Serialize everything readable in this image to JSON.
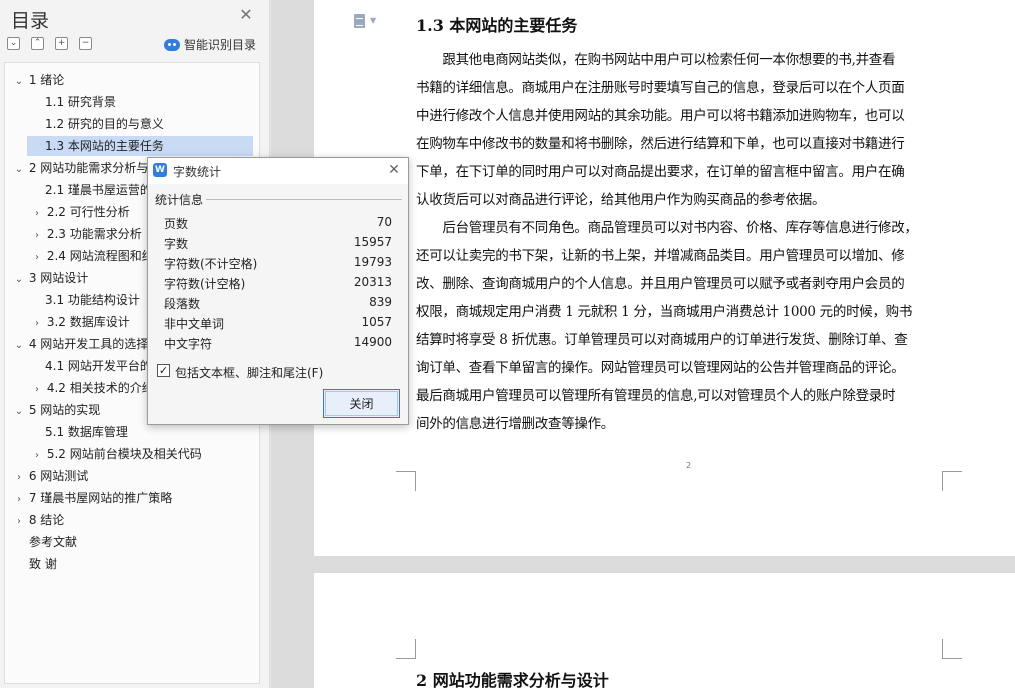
{
  "nav": {
    "title": "目录",
    "close_glyph": "✕",
    "tools": [
      "⌄",
      "⌃",
      "+",
      "−"
    ],
    "smart_toc_label": "智能识别目录",
    "items": [
      {
        "caret": "⌄",
        "label": "1  绪论"
      },
      {
        "caret": "",
        "label": "1.1  研究背景"
      },
      {
        "caret": "",
        "label": "1.2  研究的目的与意义"
      },
      {
        "caret": "",
        "label": "1.3  本网站的主要任务",
        "selected": true
      },
      {
        "caret": "⌄",
        "label": "2  网站功能需求分析与设计"
      },
      {
        "caret": "",
        "label": "2.1  瑾晨书屋运营的业务需求"
      },
      {
        "caret": "›",
        "label": "2.2  可行性分析"
      },
      {
        "caret": "›",
        "label": "2.3  功能需求分析"
      },
      {
        "caret": "›",
        "label": "2.4 网站流程图和结构图"
      },
      {
        "caret": "⌄",
        "label": "3  网站设计"
      },
      {
        "caret": "",
        "label": "3.1 功能结构设计"
      },
      {
        "caret": "›",
        "label": "3.2  数据库设计"
      },
      {
        "caret": "⌄",
        "label": "4  网站开发工具的选择"
      },
      {
        "caret": "",
        "label": "4.1 网站开发平台的选择"
      },
      {
        "caret": "›",
        "label": "4.2 相关技术的介绍"
      },
      {
        "caret": "⌄",
        "label": "5  网站的实现"
      },
      {
        "caret": "",
        "label": "5.1  数据库管理"
      },
      {
        "caret": "›",
        "label": "5.2  网站前台模块及相关代码"
      },
      {
        "caret": "›",
        "label": "6  网站测试"
      },
      {
        "caret": "›",
        "label": "7  瑾晨书屋网站的推广策略"
      },
      {
        "caret": "›",
        "label": "8  结论"
      },
      {
        "caret": "",
        "label": "参考文献"
      },
      {
        "caret": "",
        "label": "致    谢"
      }
    ]
  },
  "document": {
    "section_heading": "1.3 本网站的主要任务",
    "lines": [
      "　　跟其他电商网站类似，在购书网站中用户可以检索任何一本你想要的书,并查看",
      "书籍的详细信息。商城用户在注册账号时要填写自己的信息，登录后可以在个人页面",
      "中进行修改个人信息并使用网站的其余功能。用户可以将书籍添加进购物车，也可以",
      "在购物车中修改书的数量和将书删除，然后进行结算和下单，也可以直接对书籍进行",
      "下单，在下订单的同时用户可以对商品提出要求，在订单的留言框中留言。用户在确",
      "认收货后可以对商品进行评论，给其他用户作为购买商品的参考依据。",
      "　　后台管理员有不同角色。商品管理员可以对书内容、价格、库存等信息进行修改，",
      "还可以让卖完的书下架，让新的书上架，并增减商品类目。用户管理员可以增加、修",
      "改、删除、查询商城用户的个人信息。并且用户管理员可以赋予或者剥夺用户会员的",
      "权限，商城规定用户消费 1 元就积 1 分，当商城用户消费总计 1000 元的时候，购书",
      "结算时将享受 8 折优惠。订单管理员可以对商城用户的订单进行发货、删除订单、查",
      "询订单、查看下单留言的操作。网站管理员可以管理网站的公告并管理商品的评论。",
      "最后商城用户管理员可以管理所有管理员的信息,可以对管理员个人的账户除登录时",
      "间外的信息进行增删改查等操作。"
    ],
    "page_number": "2",
    "next_heading": "2  网站功能需求分析与设计"
  },
  "dialog": {
    "logo": "W",
    "title": "字数统计",
    "close_glyph": "✕",
    "stats_heading": "统计信息",
    "stats": [
      {
        "label": "页数",
        "value": "70"
      },
      {
        "label": "字数",
        "value": "15957"
      },
      {
        "label": "字符数(不计空格)",
        "value": "19793"
      },
      {
        "label": "字符数(计空格)",
        "value": "20313"
      },
      {
        "label": "段落数",
        "value": "839"
      },
      {
        "label": "非中文单词",
        "value": "1057"
      },
      {
        "label": "中文字符",
        "value": "14900"
      }
    ],
    "checkbox_checked_glyph": "✓",
    "checkbox_label": "包括文本框、脚注和尾注(F)",
    "close_button_label": "关闭"
  }
}
